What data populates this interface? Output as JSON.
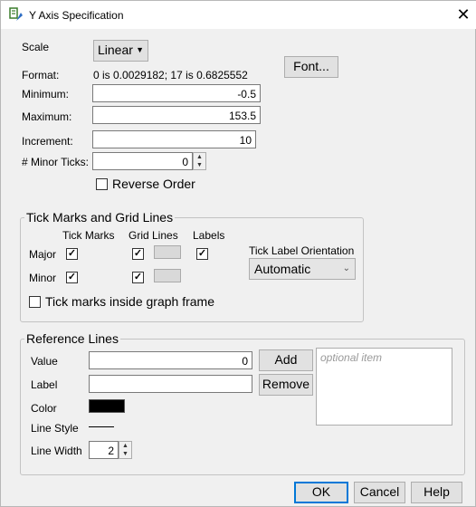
{
  "window": {
    "title": "Y Axis Specification",
    "close_glyph": "✕"
  },
  "scale": {
    "label": "Scale",
    "value": "Linear"
  },
  "format": {
    "label": "Format:",
    "value": "0 is 0.0029182; 17 is 0.6825552",
    "font_button": "Font..."
  },
  "fields": {
    "minimum_label": "Minimum:",
    "minimum_value": "-0.5",
    "maximum_label": "Maximum:",
    "maximum_value": "153.5",
    "increment_label": "Increment:",
    "increment_value": "10",
    "minor_ticks_label": "# Minor Ticks:",
    "minor_ticks_value": "0"
  },
  "reverse_order": {
    "label": "Reverse Order",
    "checked": false
  },
  "tick_group": {
    "title": "Tick Marks and Grid Lines",
    "col_tick_marks": "Tick Marks",
    "col_grid_lines": "Grid Lines",
    "col_labels": "Labels",
    "row_major": "Major",
    "row_minor": "Minor",
    "orientation_label": "Tick Label Orientation",
    "orientation_value": "Automatic",
    "inside_frame_label": "Tick marks inside graph frame",
    "check_glyph": "✓"
  },
  "reference_lines": {
    "title": "Reference Lines",
    "value_label": "Value",
    "value_value": "0",
    "label_label": "Label",
    "label_value": "",
    "color_label": "Color",
    "color_value": "#000000",
    "line_style_label": "Line Style",
    "line_width_label": "Line Width",
    "line_width_value": "2",
    "add_button": "Add",
    "remove_button": "Remove",
    "list_placeholder": "optional item"
  },
  "buttons": {
    "ok": "OK",
    "cancel": "Cancel",
    "help": "Help"
  }
}
